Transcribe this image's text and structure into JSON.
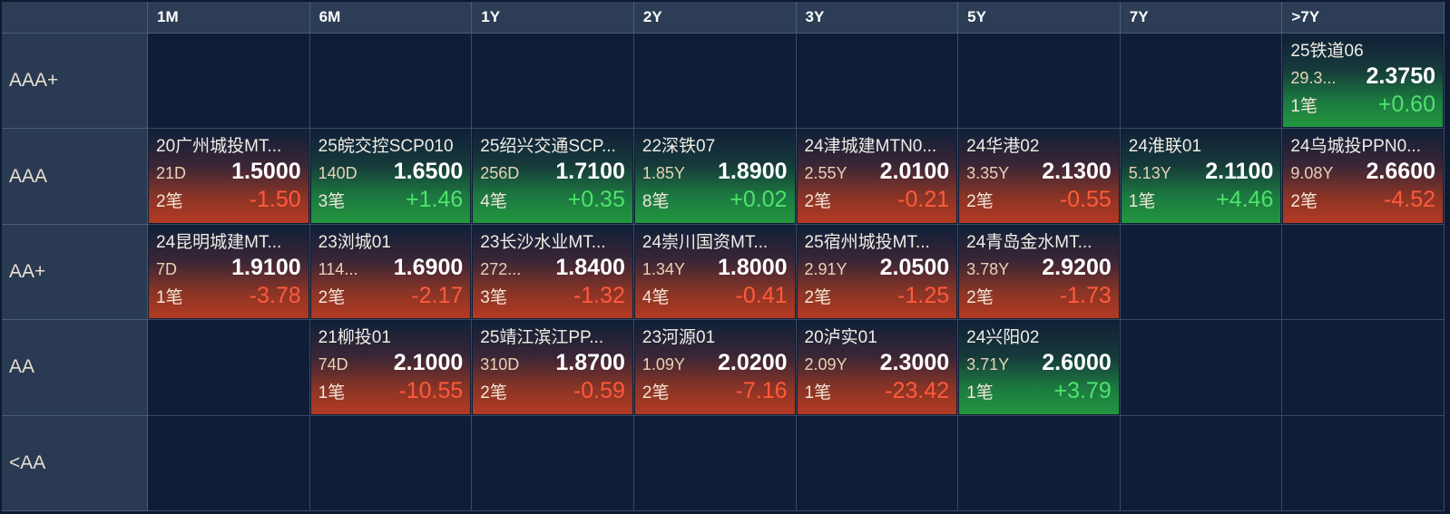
{
  "columns": [
    "1M",
    "6M",
    "1Y",
    "2Y",
    "3Y",
    "5Y",
    "7Y",
    ">7Y"
  ],
  "rows": [
    "AAA+",
    "AAA",
    "AA+",
    "AA",
    "<AA"
  ],
  "colors": {
    "up": "#23963f",
    "down": "#b43a22",
    "pos_text": "#4ee36a",
    "neg_text": "#ff5a3a"
  },
  "cards": [
    {
      "row": 0,
      "col": 7,
      "name": "25铁道06",
      "term": "29.3...",
      "yield": "2.3750",
      "count": "1笔",
      "change": "+0.60",
      "dir": "up"
    },
    {
      "row": 1,
      "col": 0,
      "name": "20广州城投MT...",
      "term": "21D",
      "yield": "1.5000",
      "count": "2笔",
      "change": "-1.50",
      "dir": "down"
    },
    {
      "row": 1,
      "col": 1,
      "name": "25皖交控SCP010",
      "term": "140D",
      "yield": "1.6500",
      "count": "3笔",
      "change": "+1.46",
      "dir": "up"
    },
    {
      "row": 1,
      "col": 2,
      "name": "25绍兴交通SCP...",
      "term": "256D",
      "yield": "1.7100",
      "count": "4笔",
      "change": "+0.35",
      "dir": "up"
    },
    {
      "row": 1,
      "col": 3,
      "name": "22深铁07",
      "term": "1.85Y",
      "yield": "1.8900",
      "count": "8笔",
      "change": "+0.02",
      "dir": "up"
    },
    {
      "row": 1,
      "col": 4,
      "name": "24津城建MTN0...",
      "term": "2.55Y",
      "yield": "2.0100",
      "count": "2笔",
      "change": "-0.21",
      "dir": "down"
    },
    {
      "row": 1,
      "col": 5,
      "name": "24华港02",
      "term": "3.35Y",
      "yield": "2.1300",
      "count": "2笔",
      "change": "-0.55",
      "dir": "down"
    },
    {
      "row": 1,
      "col": 6,
      "name": "24淮联01",
      "term": "5.13Y",
      "yield": "2.1100",
      "count": "1笔",
      "change": "+4.46",
      "dir": "up"
    },
    {
      "row": 1,
      "col": 7,
      "name": "24乌城投PPN0...",
      "term": "9.08Y",
      "yield": "2.6600",
      "count": "2笔",
      "change": "-4.52",
      "dir": "down"
    },
    {
      "row": 2,
      "col": 0,
      "name": "24昆明城建MT...",
      "term": "7D",
      "yield": "1.9100",
      "count": "1笔",
      "change": "-3.78",
      "dir": "down"
    },
    {
      "row": 2,
      "col": 1,
      "name": "23浏城01",
      "term": "114...",
      "yield": "1.6900",
      "count": "2笔",
      "change": "-2.17",
      "dir": "down"
    },
    {
      "row": 2,
      "col": 2,
      "name": "23长沙水业MT...",
      "term": "272...",
      "yield": "1.8400",
      "count": "3笔",
      "change": "-1.32",
      "dir": "down"
    },
    {
      "row": 2,
      "col": 3,
      "name": "24崇川国资MT...",
      "term": "1.34Y",
      "yield": "1.8000",
      "count": "4笔",
      "change": "-0.41",
      "dir": "down"
    },
    {
      "row": 2,
      "col": 4,
      "name": "25宿州城投MT...",
      "term": "2.91Y",
      "yield": "2.0500",
      "count": "2笔",
      "change": "-1.25",
      "dir": "down"
    },
    {
      "row": 2,
      "col": 5,
      "name": "24青岛金水MT...",
      "term": "3.78Y",
      "yield": "2.9200",
      "count": "2笔",
      "change": "-1.73",
      "dir": "down"
    },
    {
      "row": 3,
      "col": 1,
      "name": "21柳投01",
      "term": "74D",
      "yield": "2.1000",
      "count": "1笔",
      "change": "-10.55",
      "dir": "down"
    },
    {
      "row": 3,
      "col": 2,
      "name": "25靖江滨江PP...",
      "term": "310D",
      "yield": "1.8700",
      "count": "2笔",
      "change": "-0.59",
      "dir": "down"
    },
    {
      "row": 3,
      "col": 3,
      "name": "23河源01",
      "term": "1.09Y",
      "yield": "2.0200",
      "count": "2笔",
      "change": "-7.16",
      "dir": "down"
    },
    {
      "row": 3,
      "col": 4,
      "name": "20泸实01",
      "term": "2.09Y",
      "yield": "2.3000",
      "count": "1笔",
      "change": "-23.42",
      "dir": "down"
    },
    {
      "row": 3,
      "col": 5,
      "name": "24兴阳02",
      "term": "3.71Y",
      "yield": "2.6000",
      "count": "1笔",
      "change": "+3.79",
      "dir": "up"
    }
  ]
}
